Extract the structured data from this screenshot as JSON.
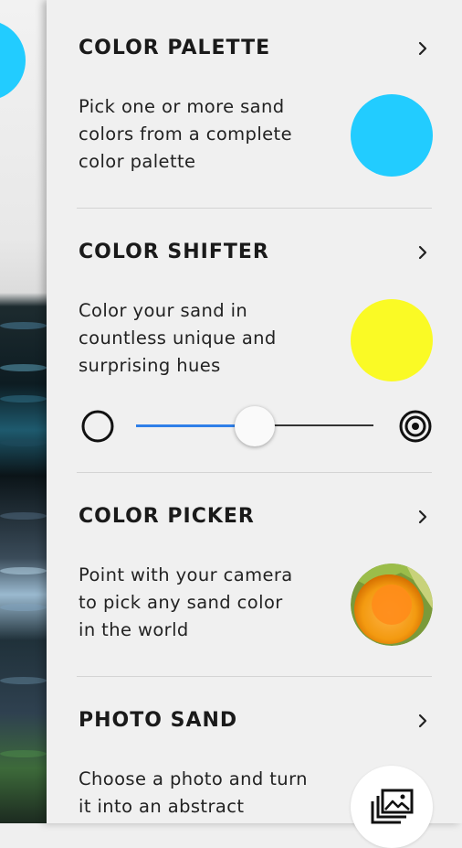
{
  "colors": {
    "palette_swatch": "#22ccff",
    "shifter_swatch": "#fafa25",
    "slider_active": "#2f7fe8",
    "picker_orange": "#ff8c1a"
  },
  "sections": {
    "palette": {
      "title": "COLOR PALETTE",
      "desc": [
        "Pick one or more sand",
        "colors from a complete",
        "color palette"
      ]
    },
    "shifter": {
      "title": "COLOR SHIFTER",
      "desc": [
        "Color your sand in",
        "countless unique and",
        "surprising hues"
      ],
      "slider_value": 0.5
    },
    "picker": {
      "title": "COLOR PICKER",
      "desc": [
        "Point with your camera",
        "to pick any sand color",
        "in the world"
      ]
    },
    "photo": {
      "title": "PHOTO SAND",
      "desc": [
        "Choose a photo and turn",
        "it into an abstract"
      ]
    }
  },
  "icons": {
    "chevron": "chevron-right-icon",
    "min_shift": "circle-outline-icon",
    "max_shift": "concentric-circles-icon",
    "gallery": "image-gallery-icon"
  }
}
